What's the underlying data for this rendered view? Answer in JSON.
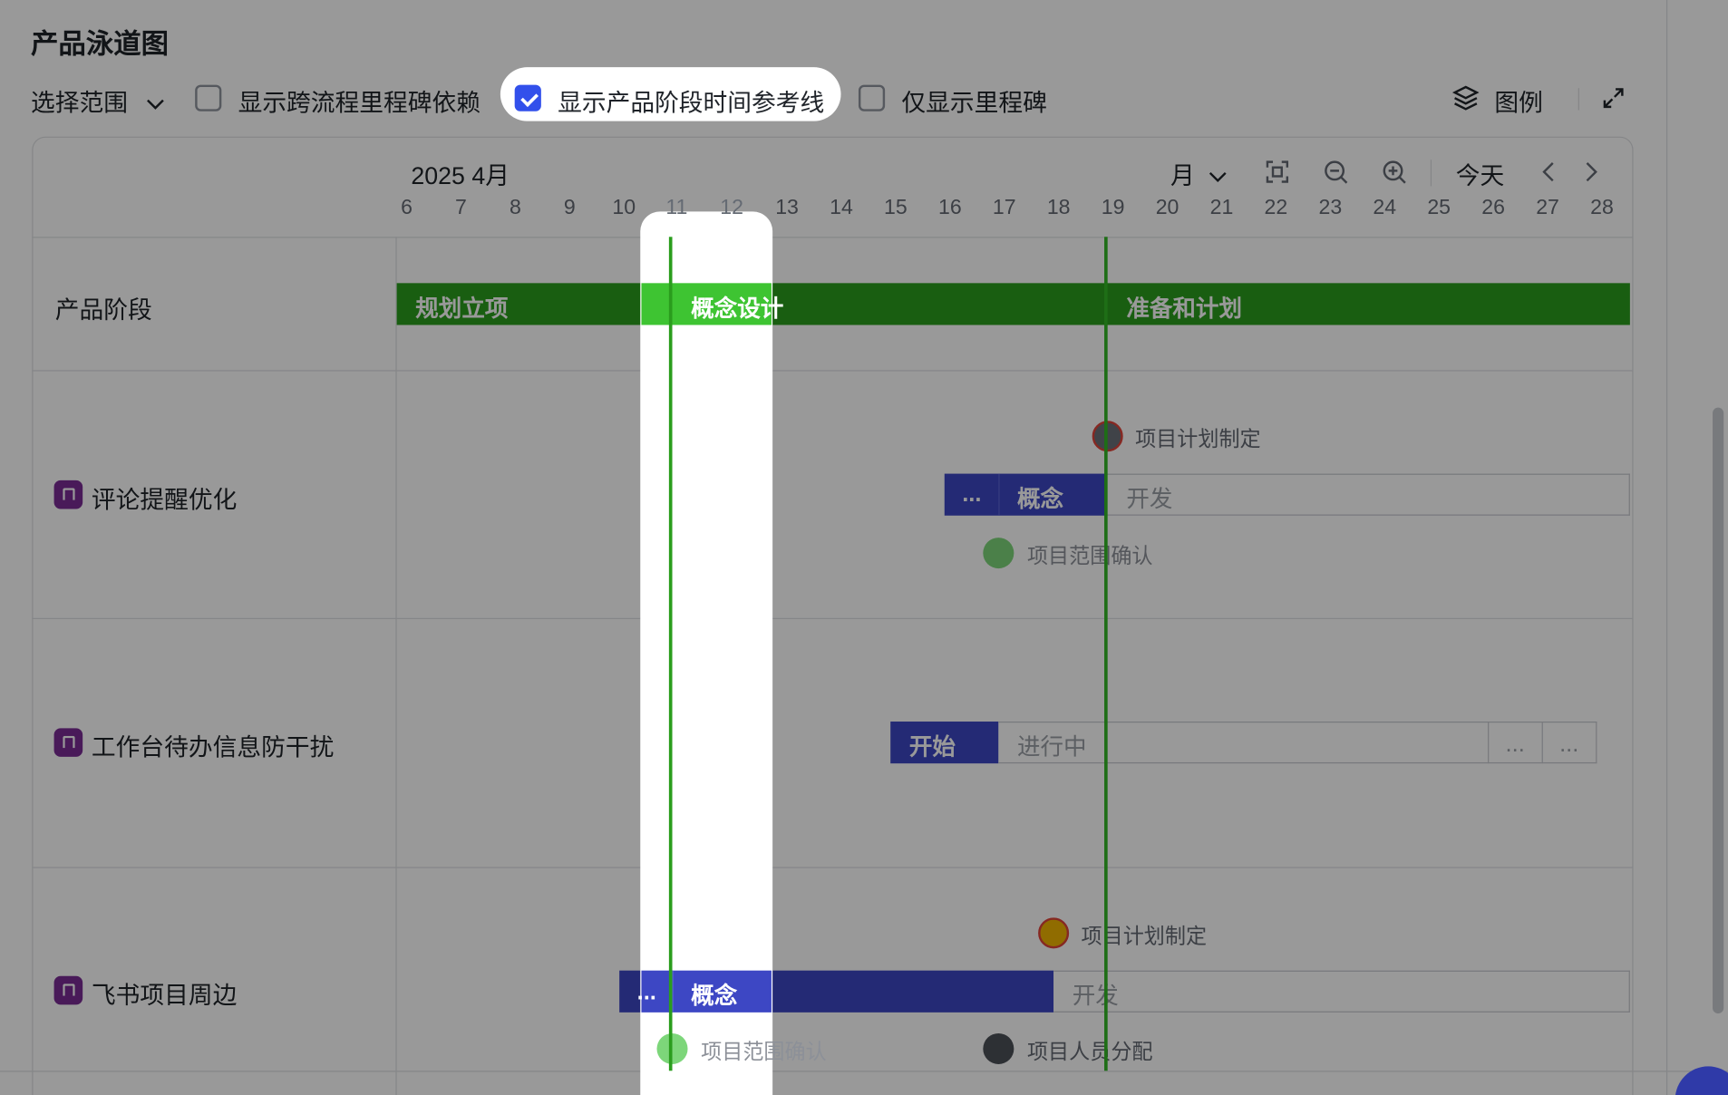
{
  "page_title": "产品泳道图",
  "toolbar": {
    "scope_label": "选择范围",
    "checkbox_cross_flow": {
      "label": "显示跨流程里程碑依赖",
      "checked": false
    },
    "checkbox_phase_ref": {
      "label": "显示产品阶段时间参考线",
      "checked": true
    },
    "checkbox_only_milestone": {
      "label": "仅显示里程碑",
      "checked": false
    },
    "legend_label": "图例"
  },
  "timeline": {
    "month_label": "2025 4月",
    "view_mode": "月",
    "today_label": "今天",
    "days": [
      "6",
      "7",
      "8",
      "9",
      "10",
      "11",
      "12",
      "13",
      "14",
      "15",
      "16",
      "17",
      "18",
      "19",
      "20",
      "21",
      "22",
      "23",
      "24",
      "25",
      "26",
      "27",
      "28"
    ]
  },
  "rows": {
    "phase": {
      "label": "产品阶段",
      "segments": [
        "规划立项",
        "概念设计",
        "准备和计划"
      ]
    },
    "row1": {
      "label": "评论提醒优化",
      "milestone_top": "项目计划制定",
      "ellipsis": "...",
      "bar_label": "概念",
      "grey_label": "开发",
      "milestone_bottom": "项目范围确认"
    },
    "row2": {
      "label": "工作台待办信息防干扰",
      "bar_label": "开始",
      "grey_label": "进行中",
      "ellipsis_a": "...",
      "ellipsis_b": "..."
    },
    "row3": {
      "label": "飞书项目周边",
      "milestone_top": "项目计划制定",
      "ellipsis": "...",
      "bar_label": "概念",
      "grey_label": "开发",
      "milestone_bottom_a": "项目范围确认",
      "milestone_bottom_b": "项目人员分配"
    }
  },
  "colors": {
    "phase_green": "#2a9d1d",
    "bar_blue": "#3d47c4",
    "row_icon_purple": "#7a2c95",
    "checkbox_blue": "#3250eb"
  }
}
